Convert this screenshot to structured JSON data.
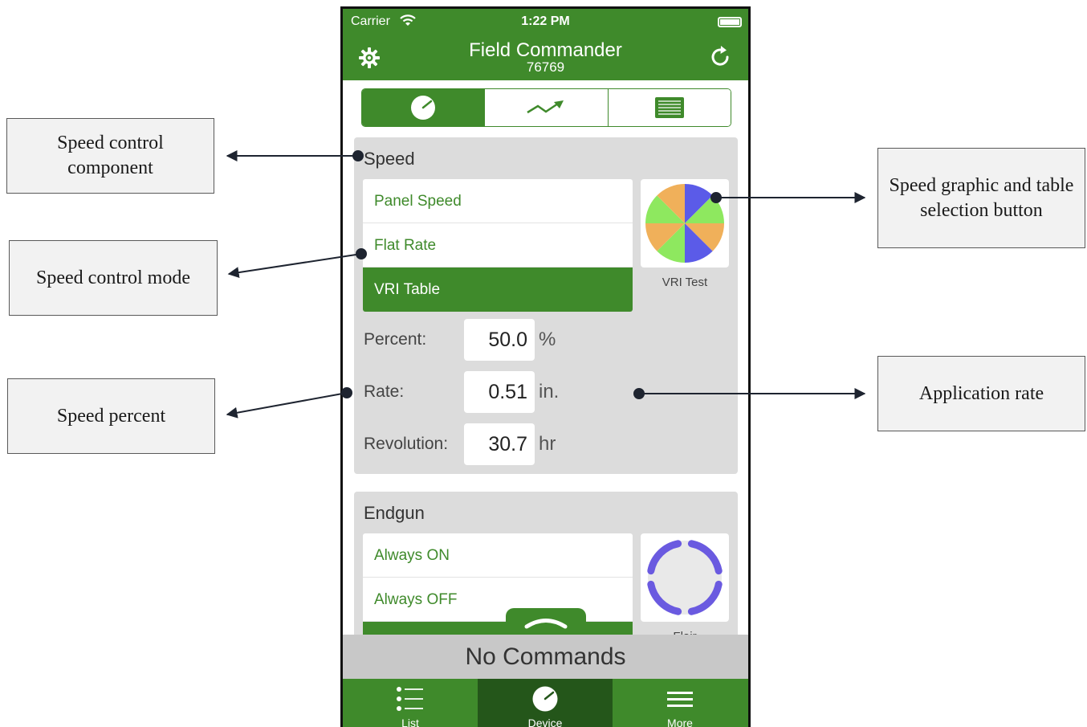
{
  "annotations": {
    "speed_component": "Speed control component",
    "speed_mode": "Speed control mode",
    "speed_percent": "Speed percent",
    "speed_graphic": "Speed graphic and table selection button",
    "application_rate": "Application rate"
  },
  "status_bar": {
    "carrier": "Carrier",
    "time": "1:22 PM"
  },
  "nav": {
    "title": "Field Commander",
    "subtitle": "76769",
    "left_icon": "gear-icon",
    "right_icon": "refresh-icon"
  },
  "segments": [
    {
      "icon": "gauge-icon",
      "active": true
    },
    {
      "icon": "trend-chart-icon",
      "active": false
    },
    {
      "icon": "table-icon",
      "active": false
    }
  ],
  "speed": {
    "title": "Speed",
    "options": [
      "Panel Speed",
      "Flat Rate",
      "VRI Table"
    ],
    "selected_option": "VRI Table",
    "thumb_label": "VRI Test",
    "fields": {
      "percent": {
        "label": "Percent:",
        "value": "50.0",
        "unit": "%"
      },
      "rate": {
        "label": "Rate:",
        "value": "0.51",
        "unit": "in."
      },
      "revolution": {
        "label": "Revolution:",
        "value": "30.7",
        "unit": "hr"
      }
    },
    "pie_colors": [
      "#5b5be8",
      "#8ee85f",
      "#f0b05a"
    ]
  },
  "endgun": {
    "title": "Endgun",
    "options": [
      "Always ON",
      "Always OFF"
    ],
    "thumb_label": "Flair",
    "ring_color": "#6a5ae0"
  },
  "command_bar": "No Commands",
  "tabs": [
    {
      "label": "List",
      "icon": "list-icon",
      "active": false
    },
    {
      "label": "Device",
      "icon": "gauge-icon",
      "active": true
    },
    {
      "label": "More",
      "icon": "menu-icon",
      "active": false
    }
  ],
  "colors": {
    "brand_green": "#3f8a2b",
    "dark_green": "#24561a",
    "card_gray": "#dcdcdc"
  }
}
